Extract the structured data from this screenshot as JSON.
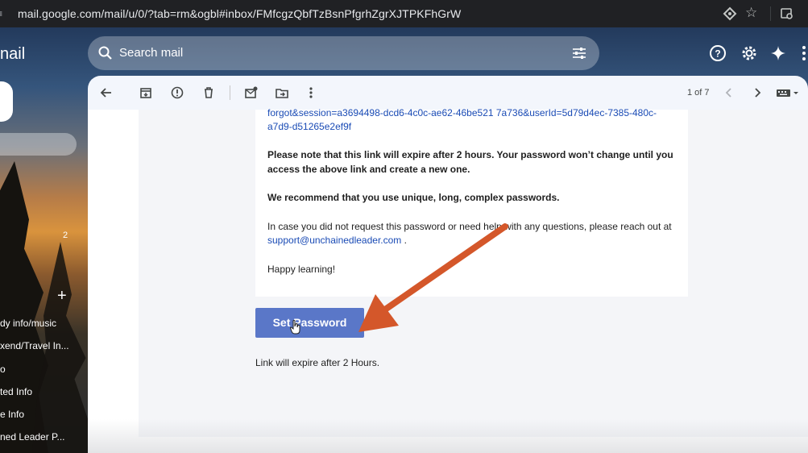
{
  "browser": {
    "url": "mail.google.com/mail/u/0/?tab=rm&ogbl#inbox/FMfcgzQbfTzBsnPfgrhZgrXJTPKFhGrW"
  },
  "header": {
    "brand": "nail",
    "search_placeholder": "Search mail"
  },
  "sidebar": {
    "inbox_count": "2",
    "labels": [
      "dy info/music",
      "xend/Travel In...",
      "o",
      "ted Info",
      "e Info",
      "ned Leader P..."
    ]
  },
  "toolbar": {
    "pagination": "1 of 7"
  },
  "email": {
    "link_line1": "forgot&session=a3694498-dcd6-4c0c-ae62-46be521 7a736&userId=5d79d4ec-7385-480c-",
    "link_line2": "a7d9-d51265e2ef9f",
    "note_line1": "Please note that this link will expire after 2 hours. Your password won’t change until you",
    "note_line2": "access the above link and create a new one.",
    "recommend": "We recommend that you use unique, long, complex passwords.",
    "help_line1": "In case you did not request this password or need help with any questions, please reach out at",
    "support_email": "support@unchainedleader.com",
    "support_suffix": " .",
    "signoff": "Happy learning!",
    "button_label": "Set Password",
    "expiry_note": "Link will expire after 2 Hours."
  },
  "colors": {
    "button": "#5a77c8",
    "link": "#1a4bb5",
    "annotation_arrow": "#d4572a"
  }
}
